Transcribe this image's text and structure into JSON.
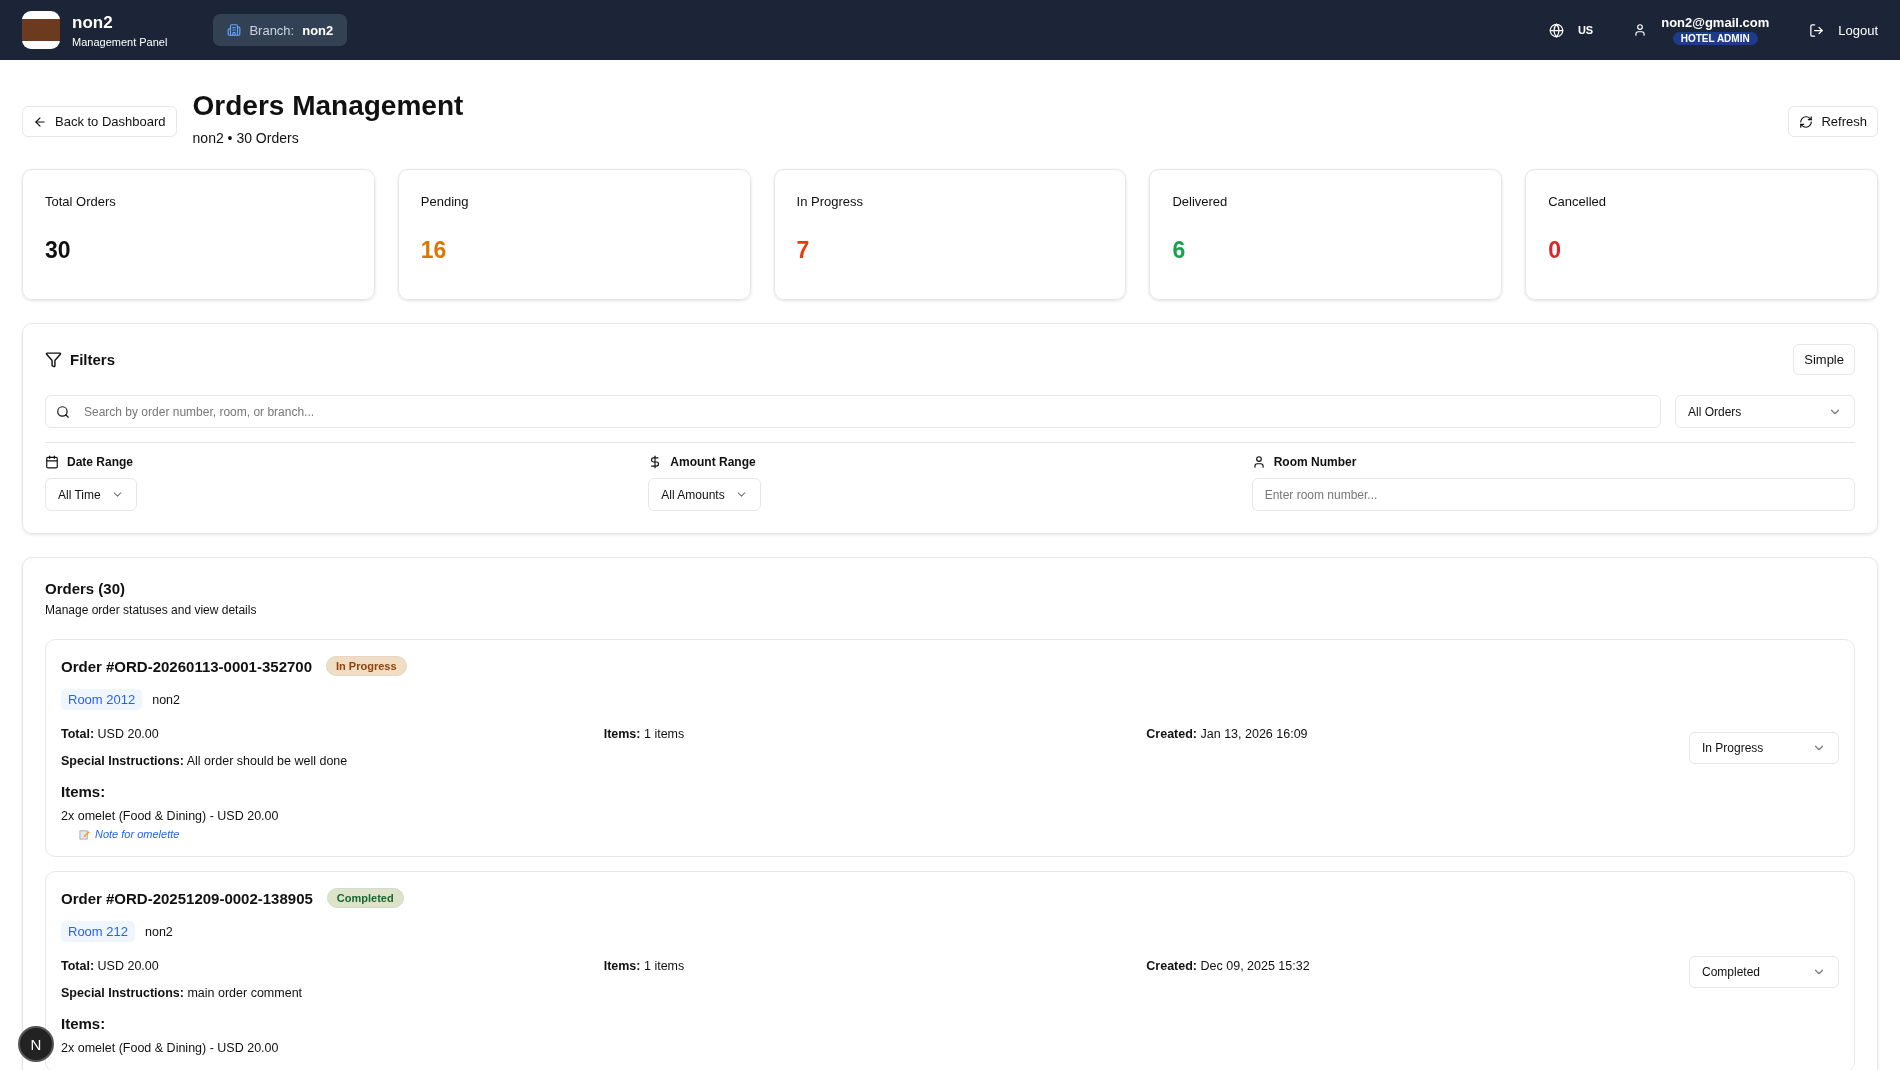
{
  "header": {
    "brand": "non2",
    "subtitle": "Management Panel",
    "branch_label": "Branch:",
    "branch_name": "non2",
    "language": "US",
    "email": "non2@gmail.com",
    "role": "HOTEL ADMIN",
    "logout": "Logout"
  },
  "page": {
    "back": "Back to Dashboard",
    "title": "Orders Management",
    "subtitle": "non2 • 30 Orders",
    "refresh": "Refresh"
  },
  "stats": [
    {
      "label": "Total Orders",
      "value": "30",
      "color": "#111111"
    },
    {
      "label": "Pending",
      "value": "16",
      "color": "#d97706"
    },
    {
      "label": "In Progress",
      "value": "7",
      "color": "#ea3a12"
    },
    {
      "label": "Delivered",
      "value": "6",
      "color": "#16a34a"
    },
    {
      "label": "Cancelled",
      "value": "0",
      "color": "#dc2626"
    }
  ],
  "filters": {
    "title": "Filters",
    "mode_button": "Simple",
    "search_placeholder": "Search by order number, room, or branch...",
    "status_select": "All Orders",
    "date_label": "Date Range",
    "date_select": "All Time",
    "amount_label": "Amount Range",
    "amount_select": "All Amounts",
    "room_label": "Room Number",
    "room_placeholder": "Enter room number..."
  },
  "orders_section": {
    "title": "Orders (30)",
    "subtitle": "Manage order statuses and view details",
    "orders": [
      {
        "number": "Order #ORD-20260113-0001-352700",
        "status": "In Progress",
        "color": "#92400e",
        "room": "Room 2012",
        "branch": "non2",
        "total_label": "Total:",
        "total": "USD 20.00",
        "items_label": "Items:",
        "items_count": "1 items",
        "created_label": "Created:",
        "created": "Jan 13, 2026 16:09",
        "instructions_label": "Special Instructions:",
        "instructions": "All order should be well done",
        "items_heading": "Items:",
        "lines": [
          {
            "text": "2x omelet (Food & Dining) - USD 20.00",
            "note": "Note for omelette"
          }
        ],
        "status_select": "In Progress"
      },
      {
        "number": "Order #ORD-20251209-0002-138905",
        "status": "Completed",
        "color": "#166534",
        "room": "Room 212",
        "branch": "non2",
        "total_label": "Total:",
        "total": "USD 20.00",
        "items_label": "Items:",
        "items_count": "1 items",
        "created_label": "Created:",
        "created": "Dec 09, 2025 15:32",
        "instructions_label": "Special Instructions:",
        "instructions": "main order comment",
        "items_heading": "Items:",
        "lines": [
          {
            "text": "2x omelet (Food & Dining) - USD 20.00"
          }
        ],
        "status_select": "Completed"
      }
    ]
  },
  "dev_badge": "N"
}
